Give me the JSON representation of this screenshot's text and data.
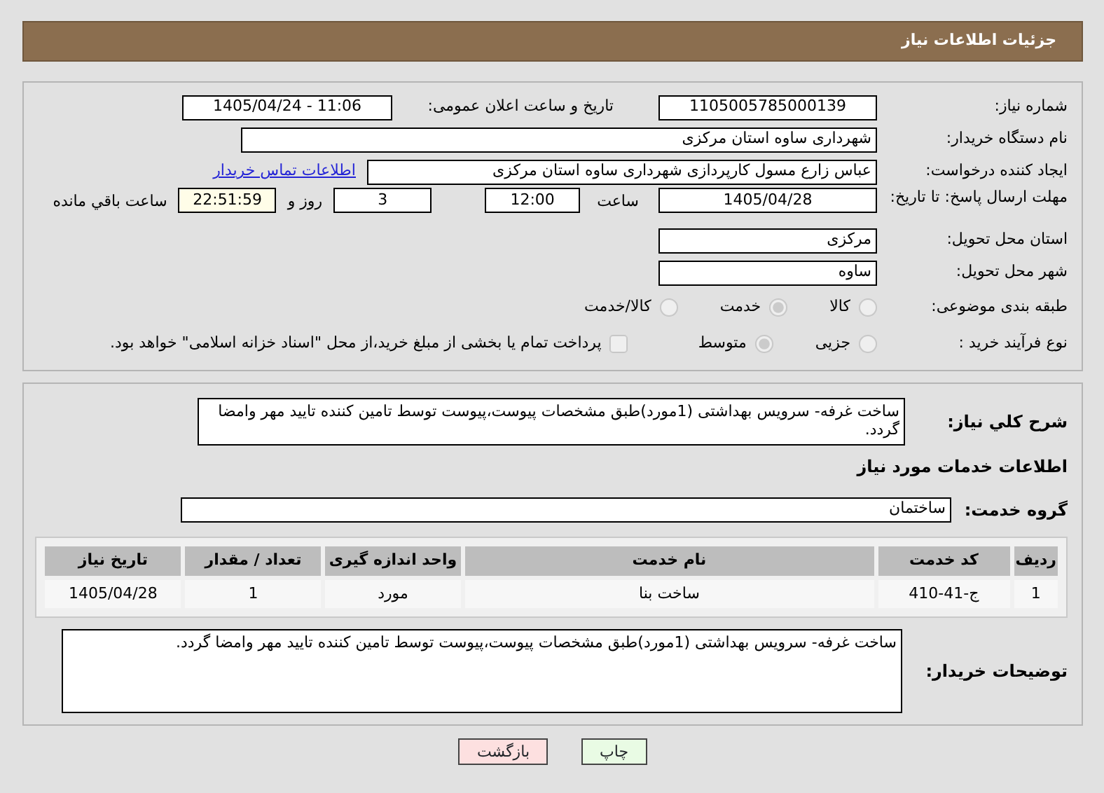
{
  "header": {
    "title": "جزئیات اطلاعات نیاز"
  },
  "fields": {
    "need_number": {
      "label": "شماره نیاز:",
      "value": "1105005785000139"
    },
    "announce": {
      "label": "تاریخ و ساعت اعلان عمومی:",
      "value": "1405/04/24 - 11:06"
    },
    "buyer": {
      "label": "نام دستگاه خریدار:",
      "value": "شهرداری ساوه استان مرکزی"
    },
    "creator": {
      "label": "ایجاد کننده درخواست:",
      "value": "عباس زارع مسول کارپردازی شهرداری ساوه استان مرکزی"
    },
    "contact_link": "اطلاعات تماس خریدار",
    "deadline": {
      "label": "مهلت ارسال پاسخ: تا تاریخ:",
      "date": "1405/04/28",
      "time_label": "ساعت",
      "time": "12:00",
      "days": "3",
      "days_label": "روز و",
      "remaining": "22:51:59",
      "remaining_label": "ساعت باقي مانده"
    },
    "province": {
      "label": "استان محل تحویل:",
      "value": "مرکزی"
    },
    "city": {
      "label": "شهر محل تحویل:",
      "value": "ساوه"
    }
  },
  "category": {
    "label": "طبقه بندی موضوعی:",
    "options": [
      {
        "label": "کالا",
        "selected": false
      },
      {
        "label": "خدمت",
        "selected": true
      },
      {
        "label": "کالا/خدمت",
        "selected": false
      }
    ]
  },
  "process": {
    "label": "نوع فرآیند خرید :",
    "options": [
      {
        "label": "جزیی",
        "selected": false
      },
      {
        "label": "متوسط",
        "selected": true
      }
    ],
    "payment": {
      "checked": false,
      "label": "پرداخت تمام یا بخشی از مبلغ خرید،از محل \"اسناد خزانه اسلامی\" خواهد بود."
    }
  },
  "description": {
    "label": "شرح کلي نیاز:",
    "value": "ساخت غرفه- سرویس بهداشتی (1مورد)طبق مشخصات پیوست،پیوست توسط تامین کننده تایید مهر وامضا گردد."
  },
  "services_heading": "اطلاعات خدمات مورد نیاز",
  "service_group": {
    "label": "گروه خدمت:",
    "value": "ساختمان"
  },
  "table": {
    "columns": [
      "ردیف",
      "کد خدمت",
      "نام خدمت",
      "واحد اندازه گیری",
      "تعداد / مقدار",
      "تاریخ نیاز"
    ],
    "rows": [
      [
        "1",
        "ج-41-410",
        "ساخت بنا",
        "مورد",
        "1",
        "1405/04/28"
      ]
    ]
  },
  "buyer_notes": {
    "label": "توضیحات خریدار:",
    "value": "ساخت غرفه- سرویس بهداشتی (1مورد)طبق مشخصات پیوست،پیوست توسط تامین کننده تایید مهر وامضا گردد."
  },
  "buttons": [
    {
      "kind": "print",
      "label": "چاپ"
    },
    {
      "kind": "back",
      "label": "بازگشت"
    }
  ]
}
